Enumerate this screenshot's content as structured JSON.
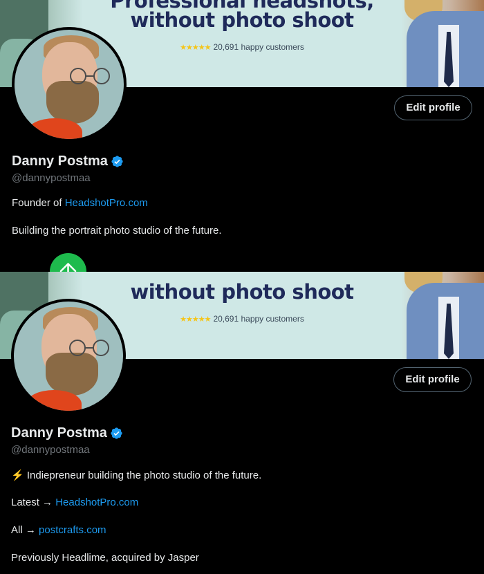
{
  "before": {
    "banner": {
      "headline_top": "Professional headshots,",
      "headline": "without photo shoot",
      "rating_stars": "★★★★★",
      "rating_text": "20,691 happy customers"
    },
    "edit_profile": "Edit profile",
    "name": "Danny Postma",
    "handle": "@dannypostmaa",
    "bio": {
      "founder_prefix": "Founder of ",
      "founder_link": "HeadshotPro.com",
      "tagline": "Building the portrait photo studio of the future."
    }
  },
  "after": {
    "banner": {
      "headline": "without photo shoot",
      "rating_stars": "★★★★★",
      "rating_text": "20,691 happy customers"
    },
    "edit_profile": "Edit profile",
    "name": "Danny Postma",
    "handle": "@dannypostmaa",
    "bio": {
      "line1_icon": "⚡",
      "line1": " Indiepreneur building the photo studio of the future.",
      "latest_prefix": "Latest → ",
      "latest_link": "HeadshotPro.com",
      "all_prefix": "All → ",
      "all_link": "postcrafts.com",
      "previously": "Previously Headlime, acquired by Jasper"
    }
  },
  "colors": {
    "link": "#1d9bf0",
    "verified": "#1d9bf0",
    "divider": "#1ebb4d"
  },
  "icons": {
    "verified": "verified-badge-icon",
    "arrow": "arrow-up-icon"
  }
}
